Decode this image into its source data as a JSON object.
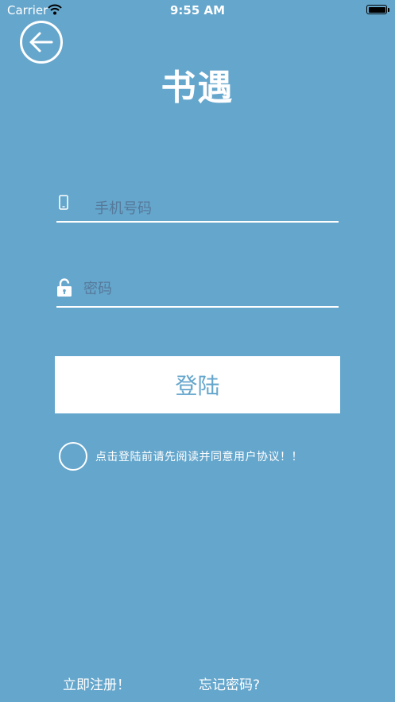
{
  "status_bar": {
    "carrier": "Carrier",
    "time": "9:55 AM"
  },
  "header": {
    "title": "书遇"
  },
  "form": {
    "phone": {
      "placeholder": "手机号码",
      "value": ""
    },
    "password": {
      "placeholder": "密码",
      "value": ""
    },
    "login_label": "登陆"
  },
  "agreement": {
    "text": "点击登陆前请先阅读并同意用户协议！！",
    "checked": false
  },
  "footer": {
    "register_label": "立即注册！",
    "forgot_label": "忘记密码?"
  },
  "colors": {
    "background": "#65a6cc",
    "foreground": "#ffffff",
    "placeholder": "#56799a"
  },
  "icons": [
    "back-arrow-icon",
    "phone-icon",
    "lock-icon",
    "wifi-icon",
    "battery-icon"
  ]
}
